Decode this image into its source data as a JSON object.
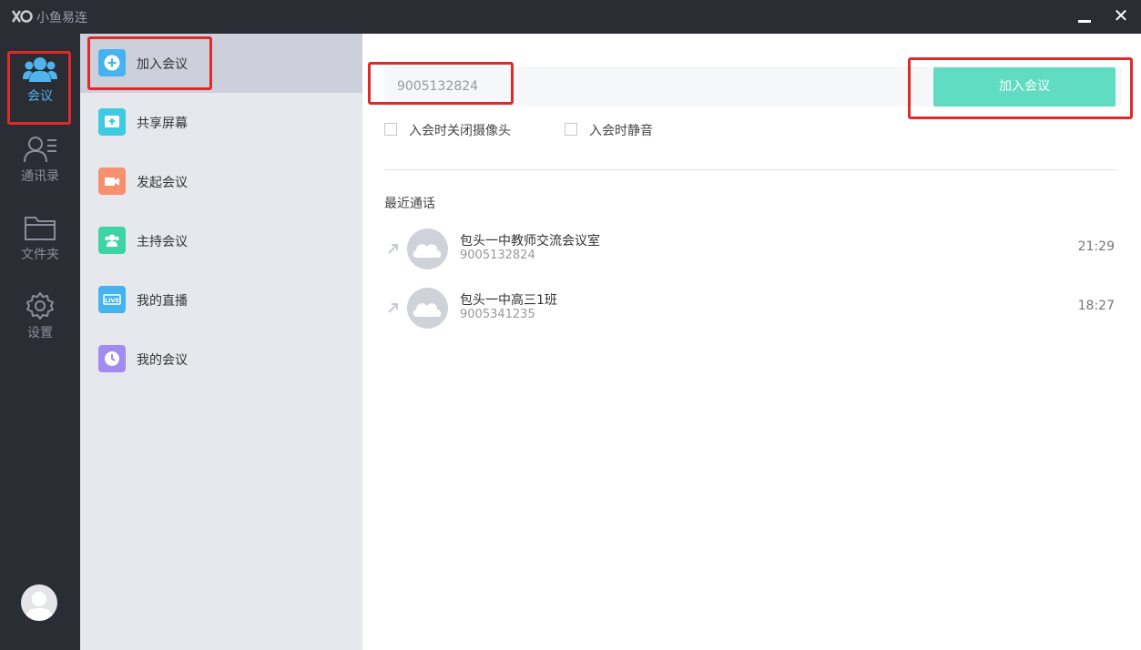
{
  "app": {
    "title": "小鱼易连"
  },
  "nav": {
    "meeting": "会议",
    "contacts": "通讯录",
    "folders": "文件夹",
    "settings": "设置"
  },
  "submenu": {
    "items": [
      {
        "label": "加入会议",
        "icon": "plus-circle-icon",
        "color": "#45b3ee"
      },
      {
        "label": "共享屏幕",
        "icon": "share-screen-icon",
        "color": "#3ccbe0"
      },
      {
        "label": "发起会议",
        "icon": "video-camera-icon",
        "color": "#f7906e"
      },
      {
        "label": "主持会议",
        "icon": "host-users-icon",
        "color": "#3dd3a3"
      },
      {
        "label": "我的直播",
        "icon": "live-icon",
        "color": "#45b3ee"
      },
      {
        "label": "我的会议",
        "icon": "clock-icon",
        "color": "#a28cf0"
      }
    ]
  },
  "join": {
    "meeting_id": "9005132824",
    "button": "加入会议",
    "option_camera_off": "入会时关闭摄像头",
    "option_mute": "入会时静音"
  },
  "recent": {
    "title": "最近通话",
    "calls": [
      {
        "name": "包头一中教师交流会议室",
        "number": "9005132824",
        "time": "21:29"
      },
      {
        "name": "包头一中高三1班",
        "number": "9005341235",
        "time": "18:27"
      }
    ]
  },
  "colors": {
    "accent": "#4fb3ec",
    "join_button": "#5fdcc1",
    "highlight": "#e02a2a"
  }
}
